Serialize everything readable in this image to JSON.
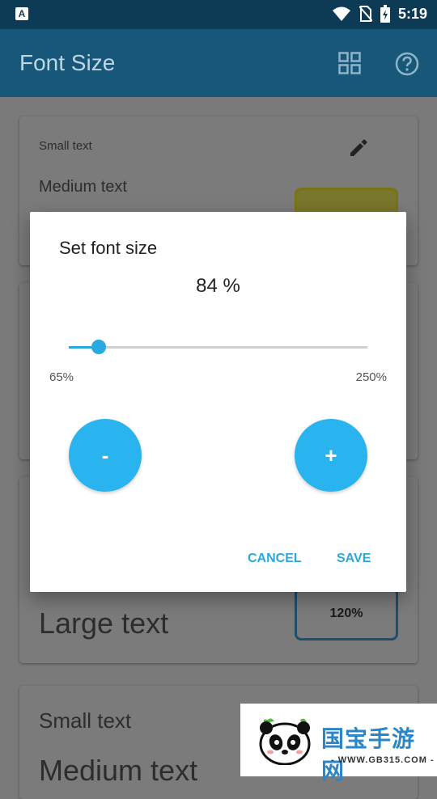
{
  "status_bar": {
    "app_badge": "A",
    "time": "5:19",
    "icons": [
      "wifi-icon",
      "no-sim-icon",
      "battery-charging-icon"
    ]
  },
  "app_bar": {
    "title": "Font Size",
    "icons": [
      "grid-view-icon",
      "help-icon"
    ]
  },
  "background_cards": {
    "card1": {
      "small": "Small text",
      "medium": "Medium text"
    },
    "card3": {
      "large": "Large text",
      "size_value": "120%"
    },
    "card4": {
      "small": "Small text",
      "medium_partial": "Medium text"
    }
  },
  "dialog": {
    "title": "Set font size",
    "value_label": "84 %",
    "slider": {
      "min_label": "65%",
      "max_label": "250%",
      "value_fraction": 0.1
    },
    "minus_label": "-",
    "plus_label": "+",
    "cancel_label": "CANCEL",
    "save_label": "SAVE"
  },
  "watermark": {
    "brand": "国宝手游网",
    "url": "- WWW.GB315.COM -"
  },
  "colors": {
    "accent": "#29b4f0",
    "appbar_dim": "#17577a",
    "statusbar_dim": "#0d3a55"
  }
}
